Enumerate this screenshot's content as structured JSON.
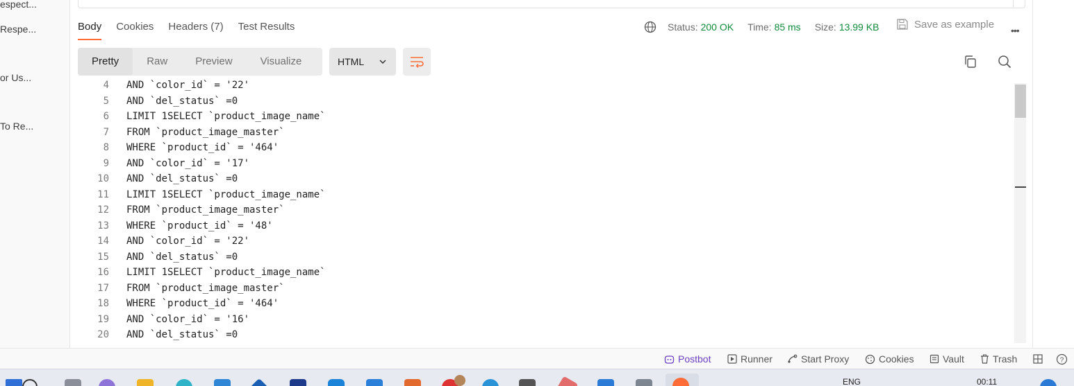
{
  "sidebar": {
    "items": [
      {
        "label": "espect..."
      },
      {
        "label": "Respe..."
      },
      {
        "label": "or Us..."
      },
      {
        "label": "To Re..."
      }
    ]
  },
  "response": {
    "tabs": [
      {
        "label": "Body",
        "active": true
      },
      {
        "label": "Cookies"
      },
      {
        "label": "Headers",
        "count": "(7)"
      },
      {
        "label": "Test Results"
      }
    ],
    "status": {
      "label": "Status:",
      "value": "200 OK"
    },
    "time": {
      "label": "Time:",
      "value": "85 ms"
    },
    "size": {
      "label": "Size:",
      "value": "13.99 KB"
    },
    "save_example": "Save as example",
    "more": "•••"
  },
  "view": {
    "modes": [
      "Pretty",
      "Raw",
      "Preview",
      "Visualize"
    ],
    "active_mode": "Pretty",
    "language": "HTML"
  },
  "editor": {
    "lines": [
      {
        "n": "4",
        "text": "AND `color_id` = '22'"
      },
      {
        "n": "5",
        "text": "AND `del_status` =0"
      },
      {
        "n": "6",
        "text": "LIMIT 1SELECT `product_image_name`"
      },
      {
        "n": "7",
        "text": "FROM `product_image_master`"
      },
      {
        "n": "8",
        "text": "WHERE `product_id` = '464'"
      },
      {
        "n": "9",
        "text": "AND `color_id` = '17'"
      },
      {
        "n": "10",
        "text": "AND `del_status` =0"
      },
      {
        "n": "11",
        "text": "LIMIT 1SELECT `product_image_name`"
      },
      {
        "n": "12",
        "text": "FROM `product_image_master`"
      },
      {
        "n": "13",
        "text": "WHERE `product_id` = '48'"
      },
      {
        "n": "14",
        "text": "AND `color_id` = '22'"
      },
      {
        "n": "15",
        "text": "AND `del_status` =0"
      },
      {
        "n": "16",
        "text": "LIMIT 1SELECT `product_image_name`"
      },
      {
        "n": "17",
        "text": "FROM `product_image_master`"
      },
      {
        "n": "18",
        "text": "WHERE `product_id` = '464'"
      },
      {
        "n": "19",
        "text": "AND `color_id` = '16'"
      },
      {
        "n": "20",
        "text": "AND `del_status` =0"
      }
    ]
  },
  "footer": {
    "postbot": "Postbot",
    "runner": "Runner",
    "start_proxy": "Start Proxy",
    "cookies": "Cookies",
    "vault": "Vault",
    "trash": "Trash"
  },
  "taskbar": {
    "language": "ENG",
    "clock": "00:11"
  },
  "colors": {
    "accent": "#ff6c37",
    "status_ok": "#0f8a3b",
    "postbot": "#6b3fc4"
  }
}
